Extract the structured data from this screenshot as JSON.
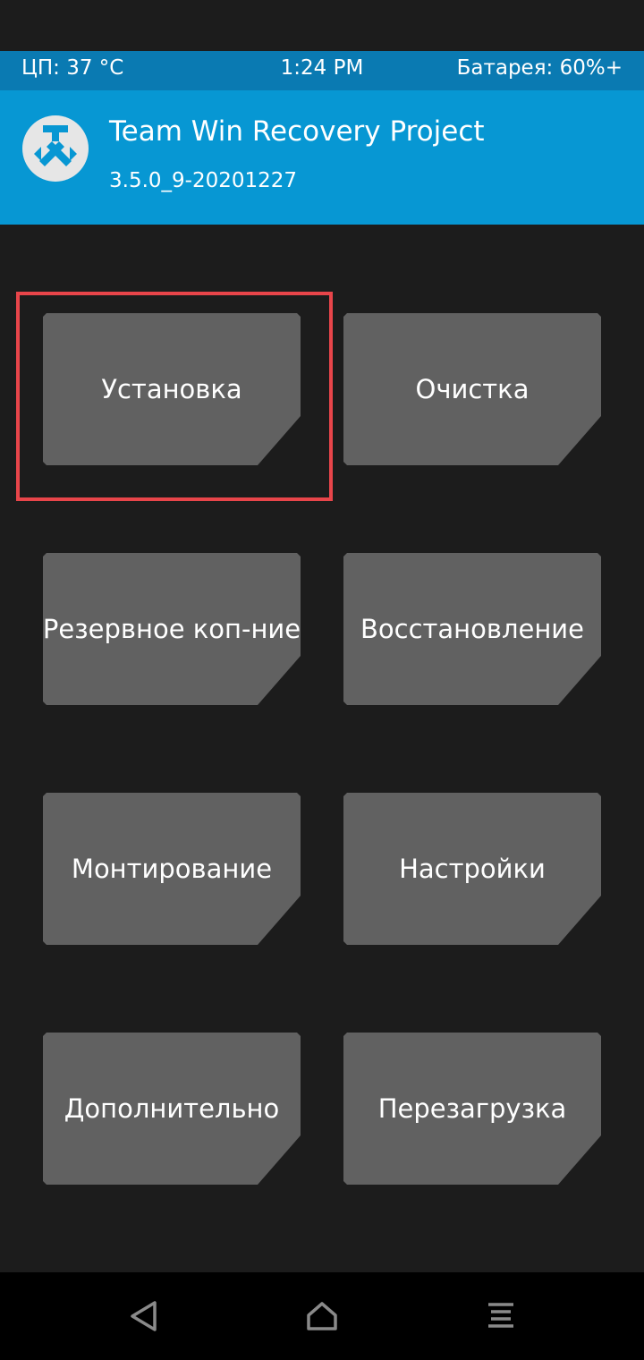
{
  "status_bar": {
    "cpu": "ЦП: 37 °C",
    "time": "1:24 PM",
    "battery": "Батарея: 60%+"
  },
  "header": {
    "title": "Team Win Recovery Project",
    "version": "3.5.0_9-20201227",
    "logo_icon": "twrp-logo-icon"
  },
  "menu": {
    "install": "Установка",
    "wipe": "Очистка",
    "backup": "Резервное коп-ние",
    "restore": "Восстановление",
    "mount": "Монтирование",
    "settings": "Настройки",
    "advanced": "Дополнительно",
    "reboot": "Перезагрузка"
  },
  "navbar": {
    "back_icon": "back-triangle-icon",
    "home_icon": "home-icon",
    "menu_icon": "menu-lines-icon"
  },
  "colors": {
    "background": "#1c1c1c",
    "status_bar": "#0a7ab2",
    "header": "#0797d3",
    "tile": "#616161",
    "highlight": "#e8454a",
    "navbar": "#000000"
  }
}
